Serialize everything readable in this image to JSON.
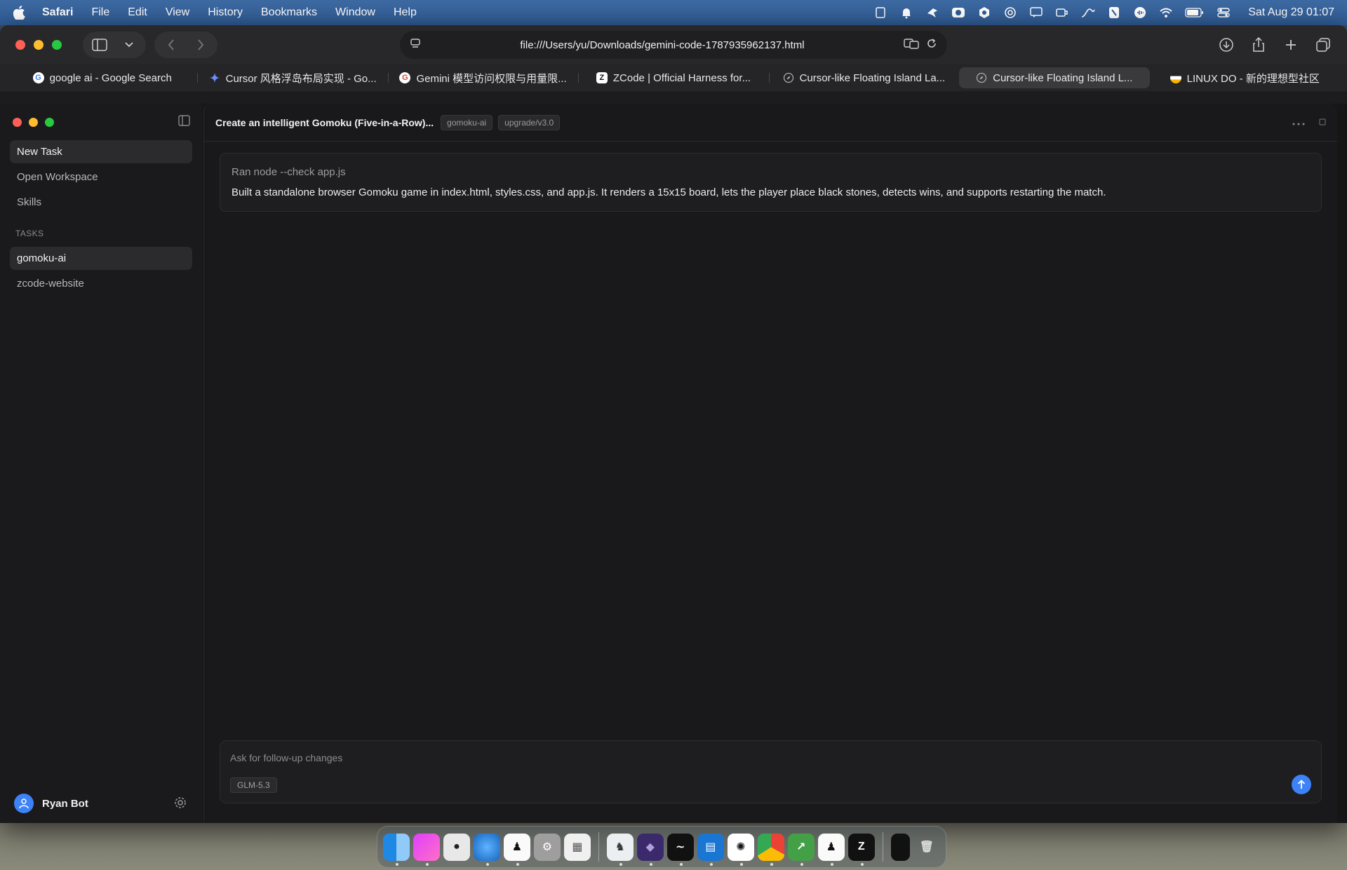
{
  "menubar": {
    "app_name": "Safari",
    "items": [
      "File",
      "Edit",
      "View",
      "History",
      "Bookmarks",
      "Window",
      "Help"
    ],
    "clock": "Sat Aug 29  01:07"
  },
  "browser": {
    "url": "file:///Users/yu/Downloads/gemini-code-1787935962137.html",
    "tabs": [
      {
        "label": "google ai - Google Search",
        "icon": "google-icon"
      },
      {
        "label": "Cursor 风格浮岛布局实现 - Go...",
        "icon": "gemini-icon"
      },
      {
        "label": "Gemini 模型访问权限与用量限...",
        "icon": "google-icon"
      },
      {
        "label": "ZCode | Official Harness for...",
        "icon": "zcode-icon"
      },
      {
        "label": "Cursor-like Floating Island La...",
        "icon": "compass-icon"
      },
      {
        "label": "Cursor-like Floating Island L...",
        "icon": "compass-icon",
        "active": true
      },
      {
        "label": "LINUX DO - 新的理想型社区",
        "icon": "linuxdo-icon"
      }
    ]
  },
  "sidebar": {
    "nav": [
      "New Task",
      "Open Workspace",
      "Skills"
    ],
    "section_title": "TASKS",
    "tasks": [
      "gomoku-ai",
      "zcode-website"
    ],
    "user_name": "Ryan Bot"
  },
  "main": {
    "task_title": "Create an intelligent Gomoku (Five-in-a-Row)...",
    "chips": [
      "gomoku-ai",
      "upgrade/v3.0"
    ],
    "message": {
      "command": "Ran node --check app.js",
      "text": "Built a standalone browser Gomoku game in index.html, styles.css, and app.js. It renders a 15x15 board, lets the player place black stones, detects wins, and supports restarting the match."
    },
    "composer": {
      "placeholder": "Ask for follow-up changes",
      "model": "GLM-5.3"
    }
  },
  "colors": {
    "accent": "#3d82f6",
    "menubar": "#2f5b94",
    "window_bg": "#1c1c1e"
  }
}
